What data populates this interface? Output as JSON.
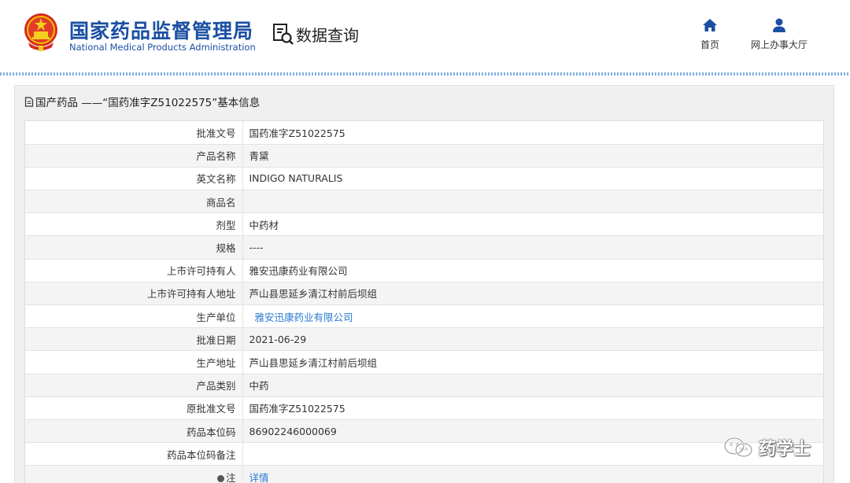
{
  "header": {
    "org_name_cn": "国家药品监督管理局",
    "org_name_en": "National Medical Products Administration",
    "query_label": "数据查询",
    "nav": [
      {
        "label": "首页",
        "icon": "home-icon"
      },
      {
        "label": "网上办事大厅",
        "icon": "user-icon"
      }
    ]
  },
  "panel": {
    "title": "国产药品 ——“国药准字Z51022575”基本信息"
  },
  "rows": [
    {
      "label": "批准文号",
      "value": "国药准字Z51022575"
    },
    {
      "label": "产品名称",
      "value": "青黛"
    },
    {
      "label": "英文名称",
      "value": "INDIGO NATURALIS"
    },
    {
      "label": "商品名",
      "value": ""
    },
    {
      "label": "剂型",
      "value": "中药材"
    },
    {
      "label": "规格",
      "value": "----"
    },
    {
      "label": "上市许可持有人",
      "value": "雅安迅康药业有限公司"
    },
    {
      "label": "上市许可持有人地址",
      "value": "芦山县思延乡清江村前后坝组"
    },
    {
      "label": "生产单位",
      "value": "雅安迅康药业有限公司"
    },
    {
      "label": "批准日期",
      "value": "2021-06-29"
    },
    {
      "label": "生产地址",
      "value": "芦山县思延乡清江村前后坝组"
    },
    {
      "label": "产品类别",
      "value": "中药"
    },
    {
      "label": "原批准文号",
      "value": "国药准字Z51022575"
    },
    {
      "label": "药品本位码",
      "value": "86902246000069"
    },
    {
      "label": "药品本位码备注",
      "value": ""
    },
    {
      "label": "注",
      "value": "详情"
    }
  ],
  "watermark": {
    "text": "药学士"
  },
  "colors": {
    "brand_blue": "#1a4fa3",
    "link_blue": "#2a7ad2",
    "nav_icon": "#1a4fa3"
  }
}
